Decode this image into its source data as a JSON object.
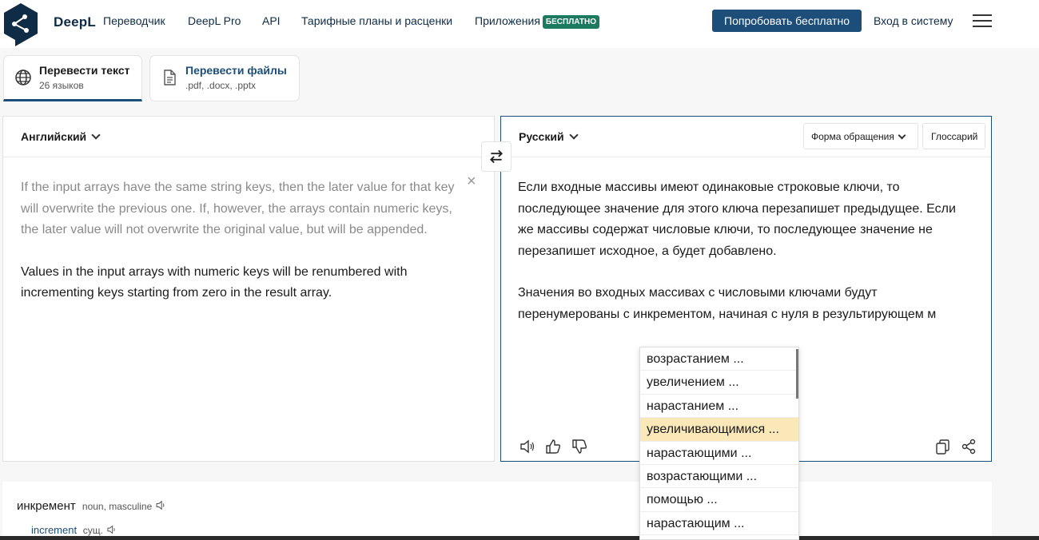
{
  "header": {
    "brand": "DeepL",
    "nav": [
      "Переводчик",
      "DeepL Pro",
      "API",
      "Тарифные планы и расценки",
      "Приложения"
    ],
    "apps_badge": "БЕСПЛАТНО",
    "try_button": "Попробовать бесплатно",
    "login": "Вход в систему"
  },
  "tabs": [
    {
      "title": "Перевести текст",
      "sub": "26 языков",
      "icon": "globe-icon"
    },
    {
      "title": "Перевести файлы",
      "sub": ".pdf, .docx, .pptx",
      "icon": "document-icon"
    }
  ],
  "source": {
    "language": "Английский",
    "text_grey": " If the input arrays have the same string keys, then the later value for that key will overwrite the previous one. If, however, the arrays contain numeric keys, the later value will not overwrite the original value, but will be appended.",
    "text_dark": "Values in the input arrays with numeric keys will be renumbered with incrementing keys starting from zero in the result array."
  },
  "target": {
    "language": "Русский",
    "formality": "Форма обращения",
    "glossary": "Глоссарий",
    "para1": " Если входные массивы имеют одинаковые строковые ключи, то последующее значение для этого ключа перезапишет предыдущее. Если же массивы содержат числовые ключи, то последующее значение не перезапишет исходное, а будет добавлено.",
    "para2": "Значения во входных массивах с числовыми ключами будут перенумерованы с инкрементом, начиная с нуля в результирующем м"
  },
  "suggestions": [
    "возрастанием ...",
    "увеличением ...",
    "нарастанием ...",
    "увеличивающимися ...",
    "нарастающими ...",
    "возрастающими ...",
    "помощью ...",
    "нарастающим ..."
  ],
  "suggestion_highlight_index": 3,
  "dictionary": {
    "word": "инкремент",
    "word_meta": "noun, masculine",
    "translation": "increment",
    "translation_meta": "сущ."
  },
  "colors": {
    "brand": "#0f2b46",
    "accent": "#1d4e79",
    "badge": "#1b7a5f",
    "highlight": "#fbe8b9"
  }
}
